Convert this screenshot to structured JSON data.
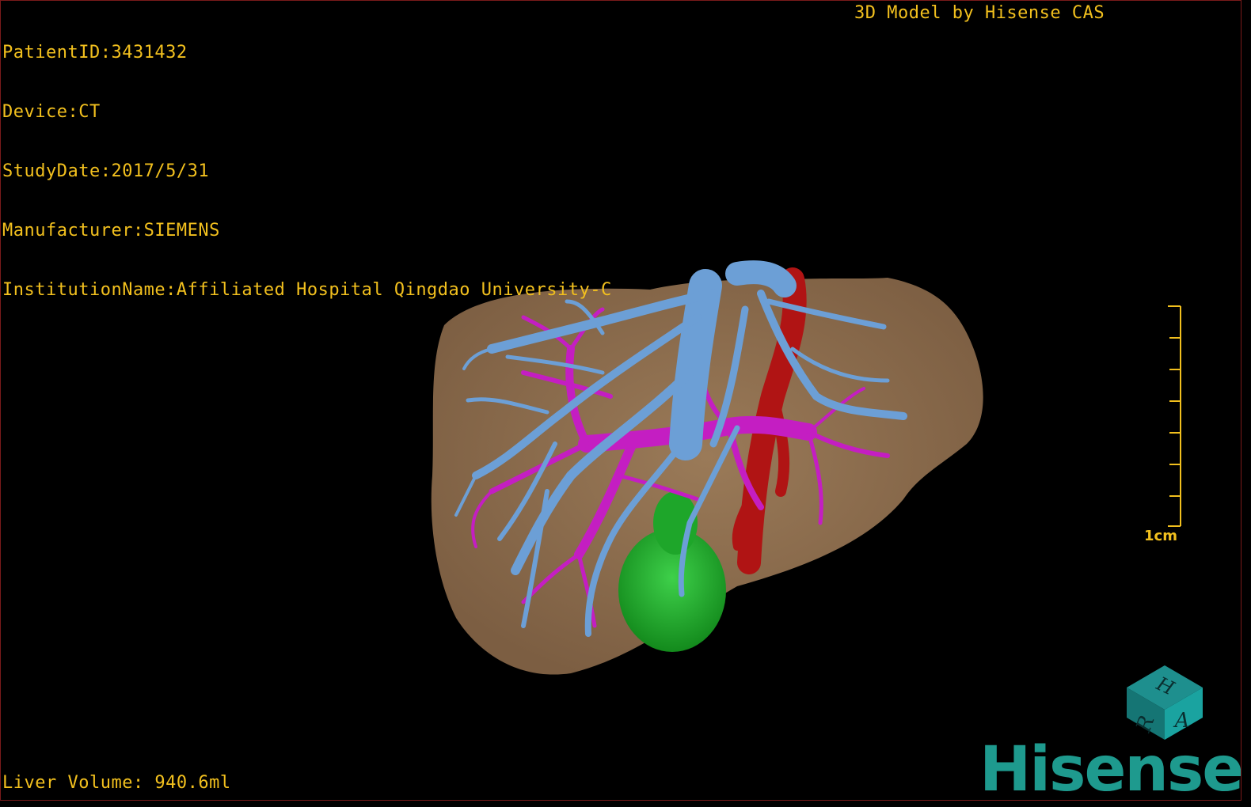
{
  "overlay": {
    "patient_id": "PatientID:3431432",
    "device": "Device:CT",
    "study_date": "StudyDate:2017/5/31",
    "manufacturer": "Manufacturer:SIEMENS",
    "institution": "InstitutionName:Affiliated Hospital Qingdao University-C",
    "model_credit": "3D Model by Hisense CAS",
    "liver_volume": "Liver Volume: 940.6ml"
  },
  "scale_bar": {
    "label": "1cm"
  },
  "orientation_cube": {
    "faces": [
      "H",
      "R",
      "A"
    ]
  },
  "brand": {
    "logo_text": "Hisense"
  },
  "colors": {
    "overlay_text": "#f2c01e",
    "liver": "#8c6c4e",
    "hepatic_vein": "#6c9fd6",
    "portal_vein": "#c41ec2",
    "artery": "#b01414",
    "gallbladder": "#1ea62a",
    "brand": "#1e9a8e"
  }
}
